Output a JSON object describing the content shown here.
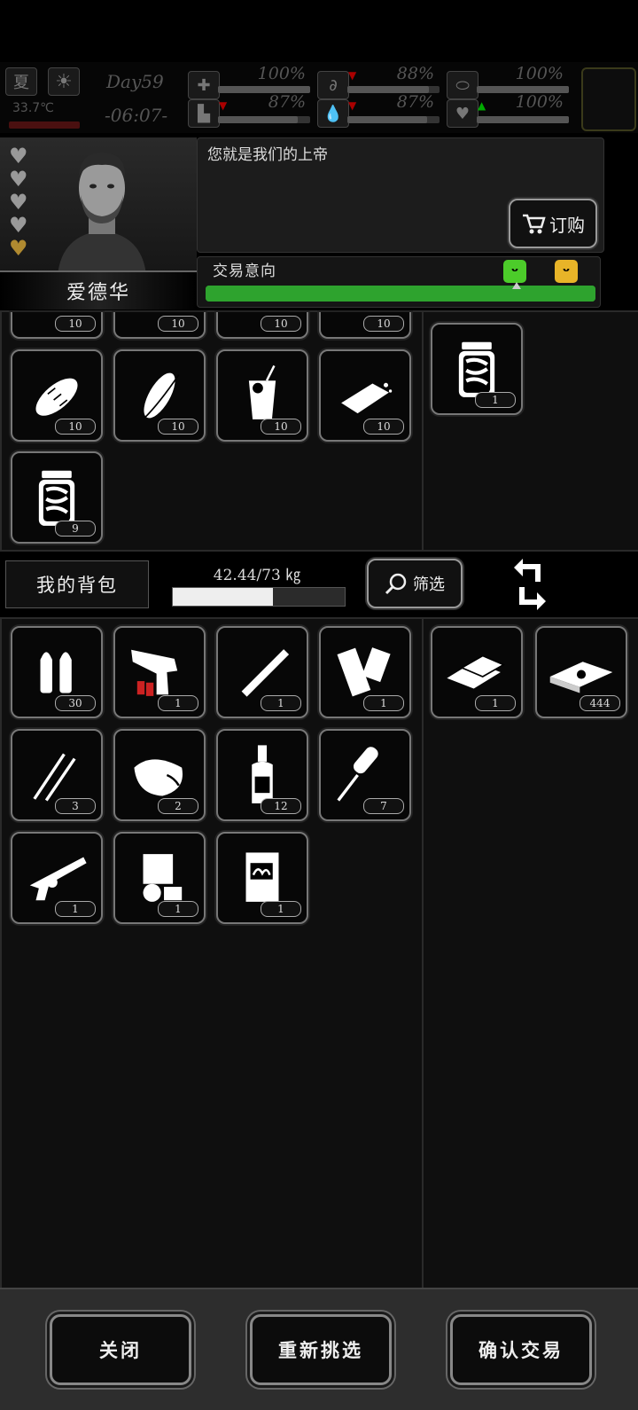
{
  "status": {
    "season": "夏",
    "temperature": "33.7℃",
    "day": "Day59",
    "time": "-06:07-",
    "stats": [
      {
        "name": "health",
        "value": "100%",
        "level": 1.0,
        "icon": "medkit-icon"
      },
      {
        "name": "hunger",
        "value": "88%",
        "level": 0.88,
        "icon": "stomach-icon",
        "trend": "down"
      },
      {
        "name": "medicine",
        "value": "100%",
        "level": 1.0,
        "icon": "pill-icon"
      },
      {
        "name": "mood",
        "value": "87%",
        "level": 0.87,
        "icon": "boot-icon",
        "trend": "down"
      },
      {
        "name": "thirst",
        "value": "87%",
        "level": 0.87,
        "icon": "water-drop-icon",
        "trend": "down"
      },
      {
        "name": "heart",
        "value": "100%",
        "level": 1.0,
        "icon": "heart-icon",
        "trend": "up"
      }
    ]
  },
  "merchant": {
    "name": "爱德华",
    "dialog": "您就是我们的上帝",
    "order_label": "订购",
    "trade_intent_label": "交易意向",
    "trade_intent_level": 1.0
  },
  "merchant_items": [
    {
      "icon": "bread-icon",
      "count": "10"
    },
    {
      "icon": "corn-icon",
      "count": "10"
    },
    {
      "icon": "lemonade-icon",
      "count": "10"
    },
    {
      "icon": "tofu-icon",
      "count": "10"
    },
    {
      "icon": "pickle-jar-icon",
      "count": "9"
    }
  ],
  "merchant_top_counts": [
    "10",
    "10",
    "10",
    "10"
  ],
  "merchant_offer": [
    {
      "icon": "pickle-jar-icon",
      "count": "1"
    }
  ],
  "bag": {
    "title": "我的背包",
    "weight": "42.44/73 ㎏",
    "weight_ratio": 0.58,
    "filter_label": "筛选"
  },
  "bag_items": [
    {
      "icon": "bullets-icon",
      "count": "30"
    },
    {
      "icon": "flare-gun-icon",
      "count": "1"
    },
    {
      "icon": "cigarette-icon",
      "count": "1"
    },
    {
      "icon": "bandage-icon",
      "count": "1"
    },
    {
      "icon": "lockpick-icon",
      "count": "3"
    },
    {
      "icon": "raw-meat-icon",
      "count": "2"
    },
    {
      "icon": "bottle-icon",
      "count": "12"
    },
    {
      "icon": "rocket-icon",
      "count": "7"
    },
    {
      "icon": "revolver-icon",
      "count": "1"
    },
    {
      "icon": "engine-icon",
      "count": "1"
    },
    {
      "icon": "book-icon",
      "count": "1"
    }
  ],
  "bag_offer": [
    {
      "icon": "gold-bars-icon",
      "count": "1"
    },
    {
      "icon": "cash-stack-icon",
      "count": "444"
    }
  ],
  "buttons": {
    "close": "关闭",
    "reselect": "重新挑选",
    "confirm": "确认交易"
  }
}
